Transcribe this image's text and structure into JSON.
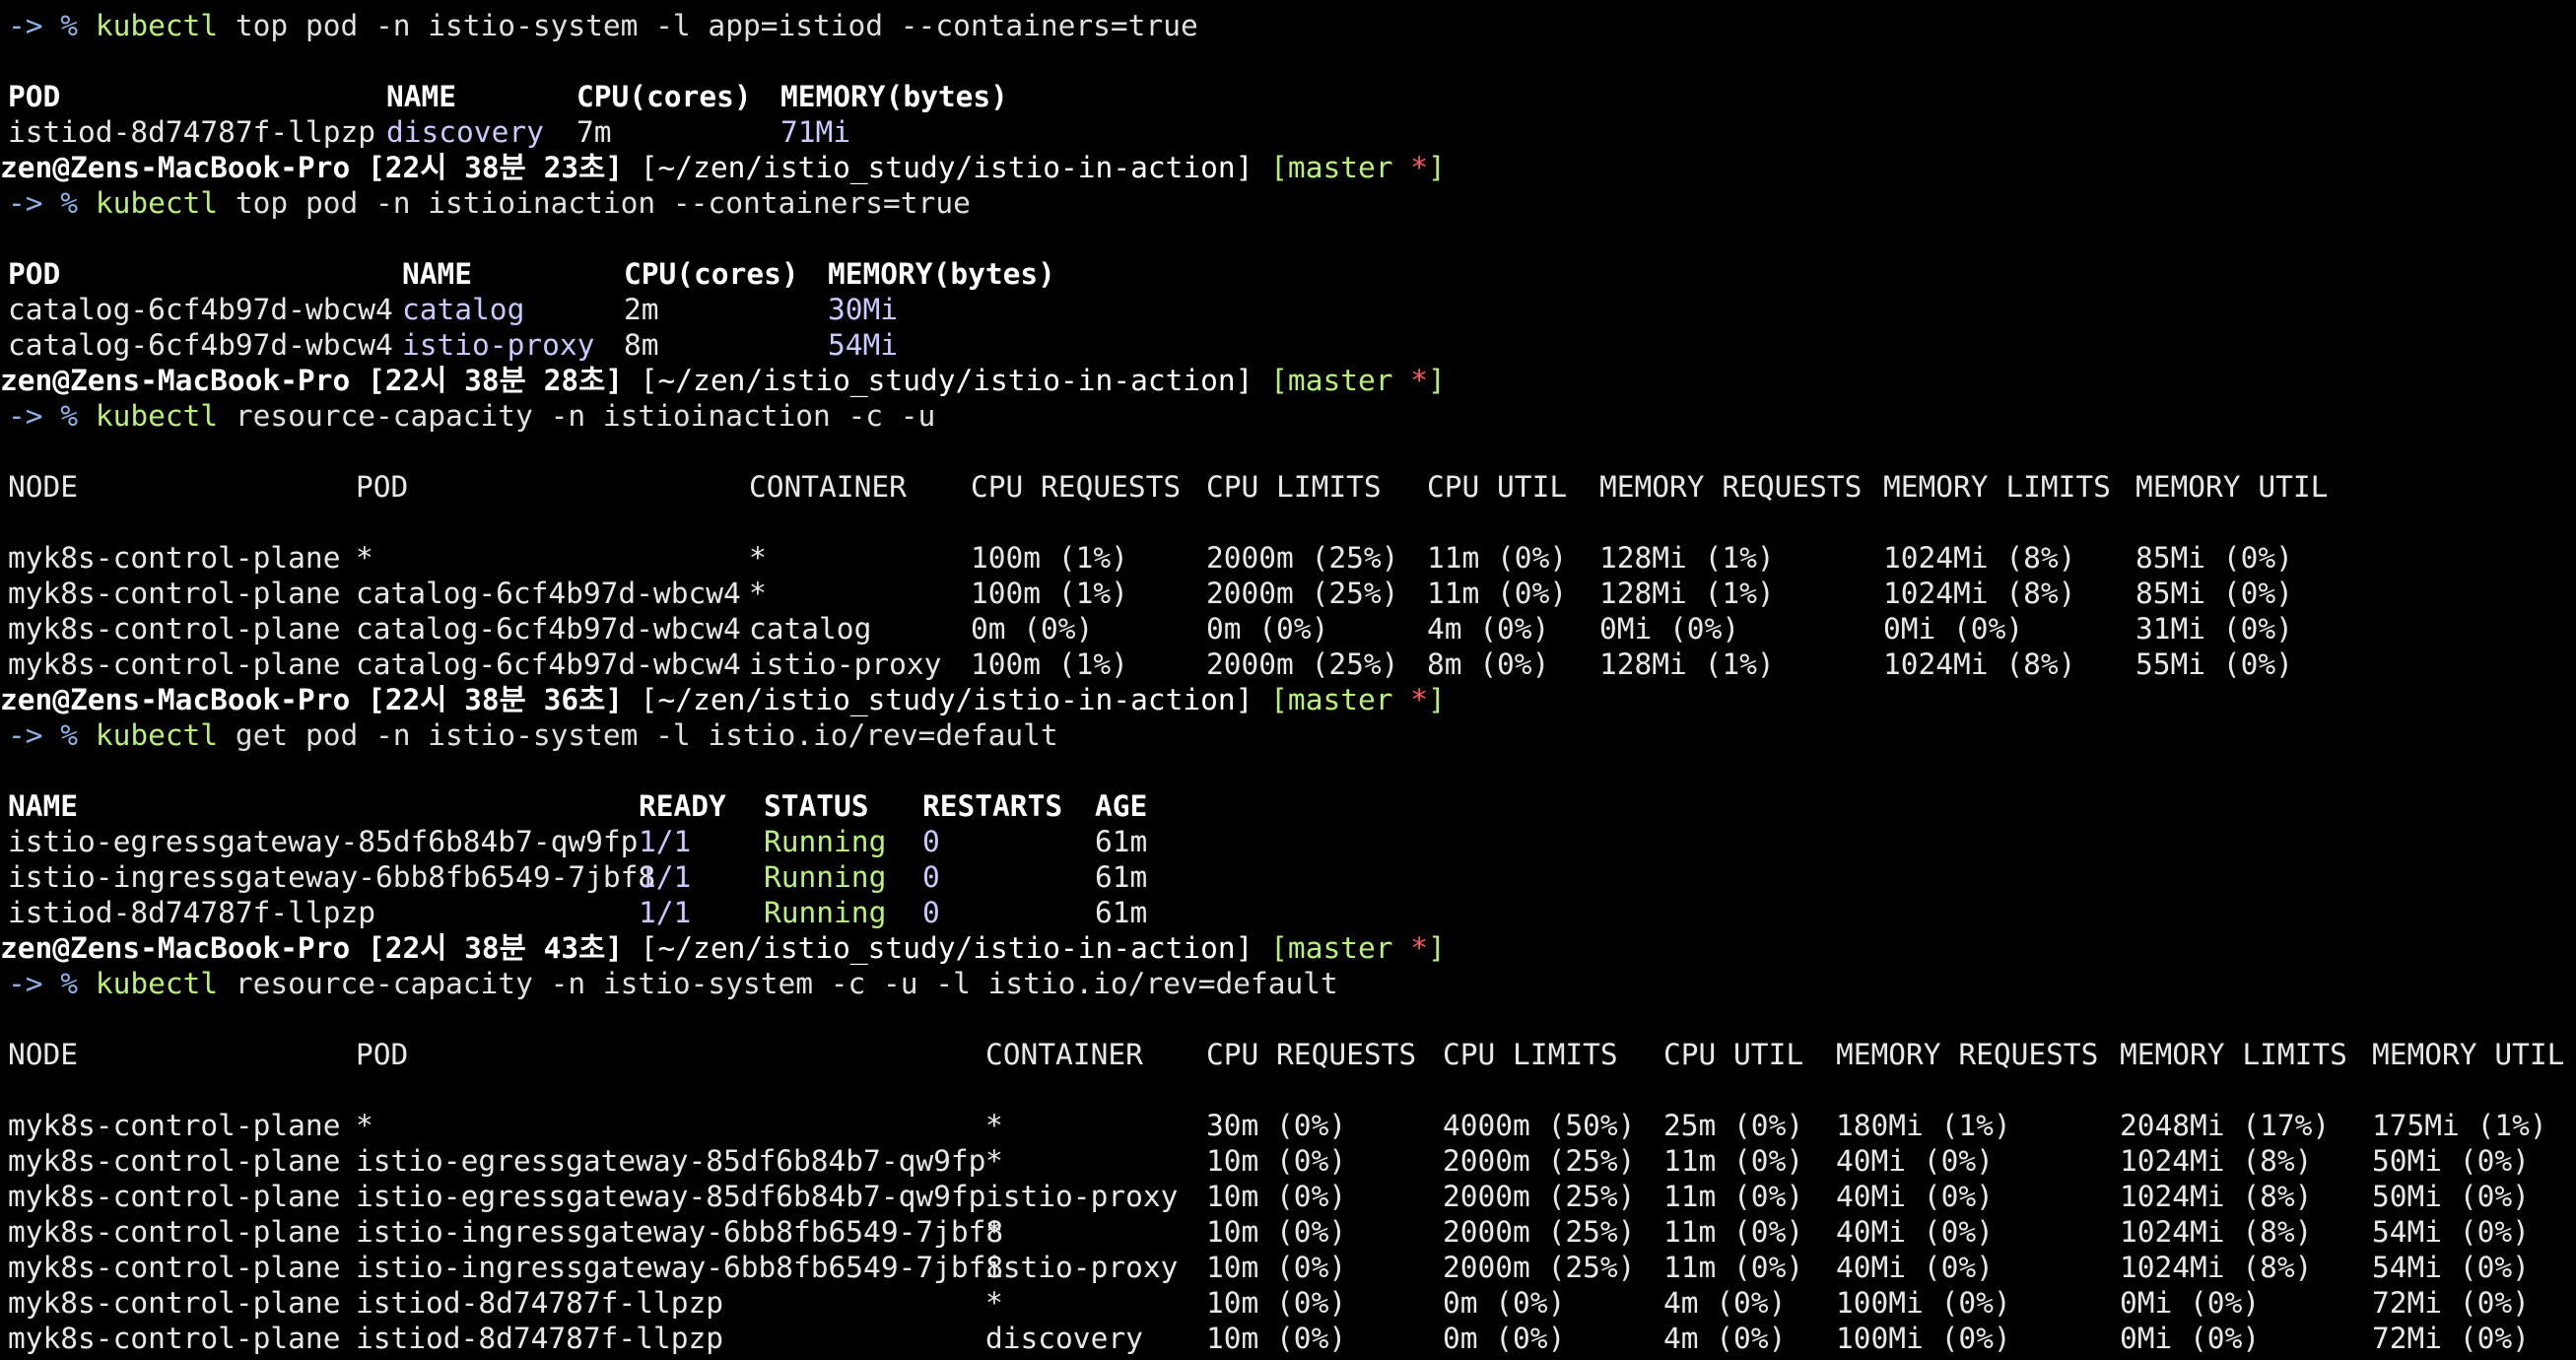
{
  "colors": {
    "background": "#000000",
    "foreground": "#e8e8e8",
    "prompt_arrow": "#8fb4e8",
    "command": "#b8f07a",
    "value_highlight": "#c7c9ff",
    "status_running": "#b8f07a",
    "git_dirty": "#ff5a5a"
  },
  "prompt": {
    "user_host": "zen@Zens-MacBook-Pro",
    "path": "[~/zen/istio_study/istio-in-action]",
    "branch_open": "[master ",
    "dirty_mark": "*",
    "branch_close": "]",
    "arrow": "-> % ",
    "times": [
      "[22시 38분 23초]",
      "[22시 38분 28초]",
      "[22시 38분 36초]",
      "[22시 38분 43초]"
    ]
  },
  "commands": [
    {
      "cmd": "kubectl",
      "args": " top pod -n istio-system -l app=istiod --containers=true"
    },
    {
      "cmd": "kubectl",
      "args": " top pod -n istioinaction --containers=true"
    },
    {
      "cmd": "kubectl",
      "args": " resource-capacity -n istioinaction -c -u"
    },
    {
      "cmd": "kubectl",
      "args": " get pod -n istio-system -l istio.io/rev=default"
    },
    {
      "cmd": "kubectl",
      "args": " resource-capacity -n istio-system -c -u -l istio.io/rev=default"
    }
  ],
  "top1": {
    "headers": [
      "POD",
      "NAME",
      "CPU(cores)",
      "MEMORY(bytes)"
    ],
    "rows": [
      [
        "istiod-8d74787f-llpzp",
        "discovery",
        "7m",
        "71Mi"
      ]
    ]
  },
  "top2": {
    "headers": [
      "POD",
      "NAME",
      "CPU(cores)",
      "MEMORY(bytes)"
    ],
    "rows": [
      [
        "catalog-6cf4b97d-wbcw4",
        "catalog",
        "2m",
        "30Mi"
      ],
      [
        "catalog-6cf4b97d-wbcw4",
        "istio-proxy",
        "8m",
        "54Mi"
      ]
    ]
  },
  "rc1": {
    "headers": [
      "NODE",
      "POD",
      "CONTAINER",
      "CPU REQUESTS",
      "CPU LIMITS",
      "CPU UTIL",
      "MEMORY REQUESTS",
      "MEMORY LIMITS",
      "MEMORY UTIL"
    ],
    "rows": [
      [
        "myk8s-control-plane",
        "*",
        "*",
        "100m (1%)",
        "2000m (25%)",
        "11m (0%)",
        "128Mi (1%)",
        "1024Mi (8%)",
        "85Mi (0%)"
      ],
      [
        "myk8s-control-plane",
        "catalog-6cf4b97d-wbcw4",
        "*",
        "100m (1%)",
        "2000m (25%)",
        "11m (0%)",
        "128Mi (1%)",
        "1024Mi (8%)",
        "85Mi (0%)"
      ],
      [
        "myk8s-control-plane",
        "catalog-6cf4b97d-wbcw4",
        "catalog",
        "0m (0%)",
        "0m (0%)",
        "4m (0%)",
        "0Mi (0%)",
        "0Mi (0%)",
        "31Mi (0%)"
      ],
      [
        "myk8s-control-plane",
        "catalog-6cf4b97d-wbcw4",
        "istio-proxy",
        "100m (1%)",
        "2000m (25%)",
        "8m (0%)",
        "128Mi (1%)",
        "1024Mi (8%)",
        "55Mi (0%)"
      ]
    ]
  },
  "getpod": {
    "headers": [
      "NAME",
      "READY",
      "STATUS",
      "RESTARTS",
      "AGE"
    ],
    "rows": [
      [
        "istio-egressgateway-85df6b84b7-qw9fp",
        "1/1",
        "Running",
        "0",
        "61m"
      ],
      [
        "istio-ingressgateway-6bb8fb6549-7jbf8",
        "1/1",
        "Running",
        "0",
        "61m"
      ],
      [
        "istiod-8d74787f-llpzp",
        "1/1",
        "Running",
        "0",
        "61m"
      ]
    ]
  },
  "rc2": {
    "headers": [
      "NODE",
      "POD",
      "CONTAINER",
      "CPU REQUESTS",
      "CPU LIMITS",
      "CPU UTIL",
      "MEMORY REQUESTS",
      "MEMORY LIMITS",
      "MEMORY UTIL"
    ],
    "rows": [
      [
        "myk8s-control-plane",
        "*",
        "*",
        "30m (0%)",
        "4000m (50%)",
        "25m (0%)",
        "180Mi (1%)",
        "2048Mi (17%)",
        "175Mi (1%)"
      ],
      [
        "myk8s-control-plane",
        "istio-egressgateway-85df6b84b7-qw9fp",
        "*",
        "10m (0%)",
        "2000m (25%)",
        "11m (0%)",
        "40Mi (0%)",
        "1024Mi (8%)",
        "50Mi (0%)"
      ],
      [
        "myk8s-control-plane",
        "istio-egressgateway-85df6b84b7-qw9fp",
        "istio-proxy",
        "10m (0%)",
        "2000m (25%)",
        "11m (0%)",
        "40Mi (0%)",
        "1024Mi (8%)",
        "50Mi (0%)"
      ],
      [
        "myk8s-control-plane",
        "istio-ingressgateway-6bb8fb6549-7jbf8",
        "*",
        "10m (0%)",
        "2000m (25%)",
        "11m (0%)",
        "40Mi (0%)",
        "1024Mi (8%)",
        "54Mi (0%)"
      ],
      [
        "myk8s-control-plane",
        "istio-ingressgateway-6bb8fb6549-7jbf8",
        "istio-proxy",
        "10m (0%)",
        "2000m (25%)",
        "11m (0%)",
        "40Mi (0%)",
        "1024Mi (8%)",
        "54Mi (0%)"
      ],
      [
        "myk8s-control-plane",
        "istiod-8d74787f-llpzp",
        "*",
        "10m (0%)",
        "0m (0%)",
        "4m (0%)",
        "100Mi (0%)",
        "0Mi (0%)",
        "72Mi (0%)"
      ],
      [
        "myk8s-control-plane",
        "istiod-8d74787f-llpzp",
        "discovery",
        "10m (0%)",
        "0m (0%)",
        "4m (0%)",
        "100Mi (0%)",
        "0Mi (0%)",
        "72Mi (0%)"
      ]
    ]
  }
}
